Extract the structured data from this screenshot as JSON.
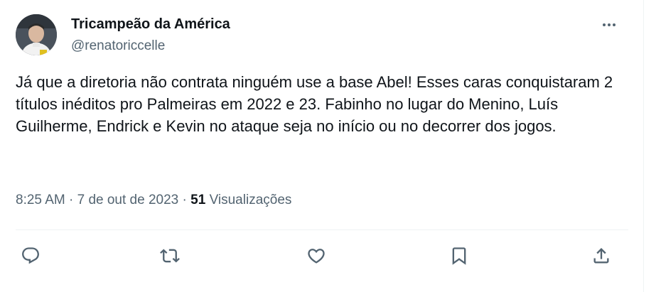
{
  "tweet": {
    "display_name": "Tricampeão da América",
    "handle": "@renatoriccelle",
    "text": "Já que a diretoria não contrata ninguém use a base Abel! Esses caras conquistaram 2 títulos inéditos pro Palmeiras em 2022 e 23. Fabinho no lugar do Menino, Luís Guilherme, Endrick e Kevin no ataque seja no início ou no decorrer dos jogos.",
    "time": "8:25 AM",
    "separator": " · ",
    "date": "7 de out de 2023",
    "views_count": "51",
    "views_label": "Visualizações"
  },
  "actions": {
    "reply_icon": "reply-icon",
    "retweet_icon": "retweet-icon",
    "like_icon": "heart-icon",
    "bookmark_icon": "bookmark-icon",
    "share_icon": "share-icon"
  },
  "colors": {
    "text_primary": "#0f1419",
    "text_secondary": "#536471",
    "divider": "#eff3f4"
  }
}
